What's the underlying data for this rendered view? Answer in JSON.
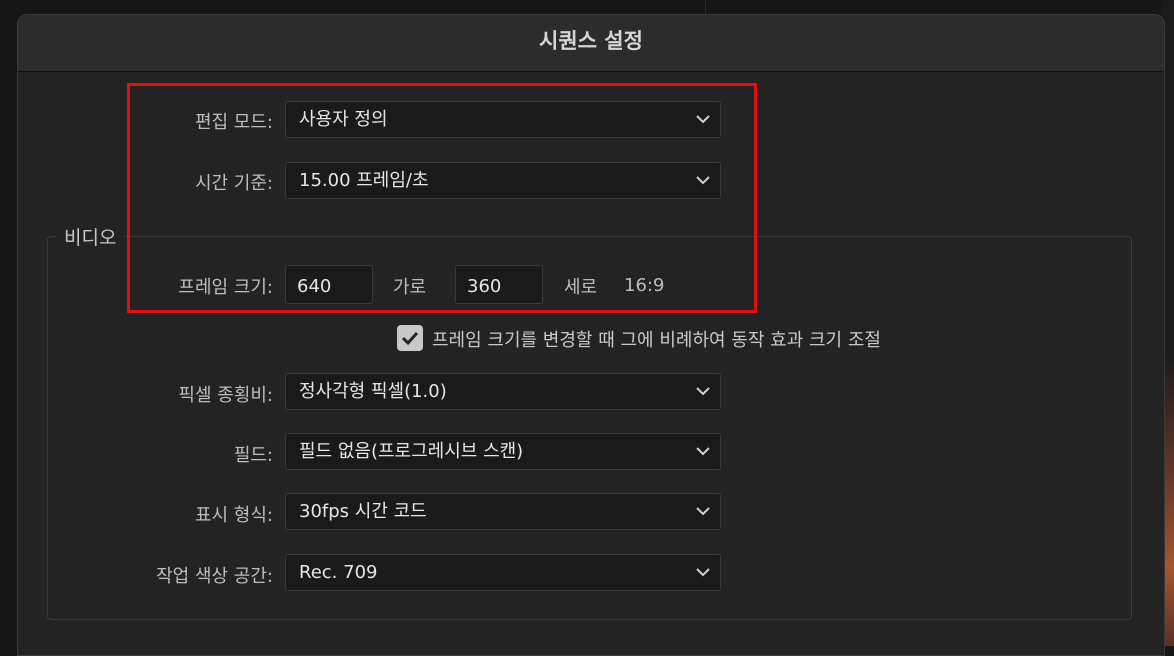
{
  "window": {
    "title": "시퀀스 설정"
  },
  "fields": {
    "edit_mode": {
      "label": "편집 모드:",
      "value": "사용자 정의"
    },
    "timebase": {
      "label": "시간 기준:",
      "value": "15.00  프레임/초"
    }
  },
  "video": {
    "group_title": "비디오",
    "frame_size": {
      "label": "프레임 크기:",
      "width": "640",
      "width_label": "가로",
      "height": "360",
      "height_label": "세로",
      "aspect": "16:9"
    },
    "scale_checkbox": {
      "label": "프레임 크기를 변경할 때 그에 비례하여 동작 효과 크기 조절",
      "checked": true
    },
    "pixel_aspect": {
      "label": "픽셀 종횡비:",
      "value": "정사각형 픽셀(1.0)"
    },
    "fields": {
      "label": "필드:",
      "value": "필드 없음(프로그레시브 스캔)"
    },
    "display_format": {
      "label": "표시 형식:",
      "value": "30fps 시간 코드"
    },
    "color_space": {
      "label": "작업 색상 공간:",
      "value": "Rec. 709"
    }
  },
  "colors": {
    "highlight": "#e01010",
    "background": "#232323"
  }
}
